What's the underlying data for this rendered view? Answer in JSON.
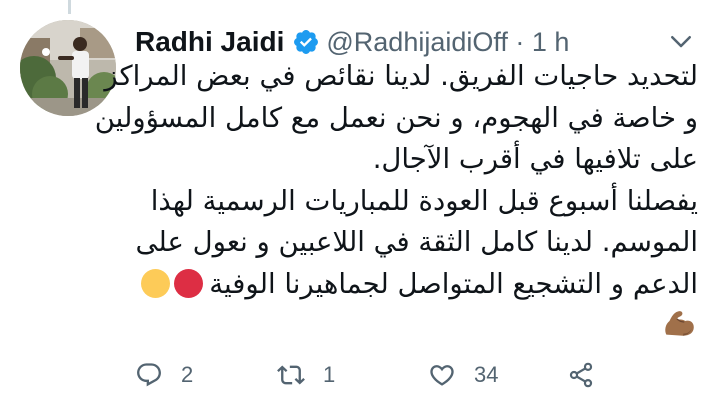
{
  "tweet": {
    "author_name": "Radhi Jaidi",
    "handle_time": "@RadhijaidiOff · 1 h",
    "lines": [
      "لتحديد حاجيات الفريق. لدينا نقائص في بعض المراكز",
      "و خاصة في الهجوم، و نحن نعمل مع كامل المسؤولين",
      "على تلافيها في أقرب الآجال.",
      "يفصلنا أسبوع قبل العودة للمباريات الرسمية لهذا",
      "الموسم. لدينا كامل الثقة في اللاعبين و نعول على",
      "الدعم و التشجيع المتواصل لجماهيرنا الوفية"
    ],
    "emojis": [
      "red-circle",
      "yellow-circle",
      "flexed-biceps-medium-dark-skin"
    ],
    "colors": {
      "red_circle": "#dd2e44",
      "yellow_circle": "#fdcb58",
      "verified": "#1d9bf0",
      "muscle": "#a0704a"
    }
  },
  "actions": {
    "reply_count": "2",
    "retweet_count": "1",
    "like_count": "34"
  },
  "icons": [
    "verified-badge-icon",
    "more-icon",
    "reply-icon",
    "retweet-icon",
    "like-icon",
    "share-icon"
  ]
}
